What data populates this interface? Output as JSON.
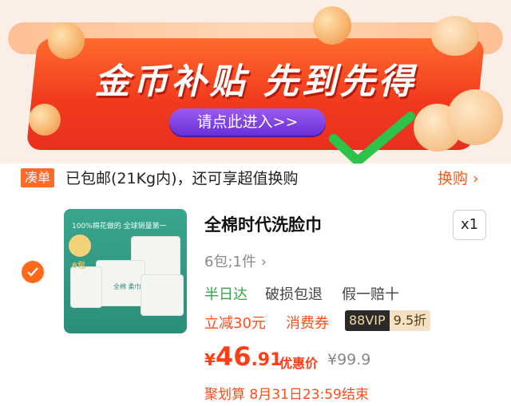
{
  "banner": {
    "title": "金币补贴 先到先得",
    "button_label": "请点此进入>>"
  },
  "shipping": {
    "tag": "凑单",
    "text": "已包邮(21Kg内)，还可享超值换购",
    "action": "换购 ›"
  },
  "product": {
    "title": "全棉时代洗脸巾",
    "quantity": "x1",
    "spec": "6包;1件 ›",
    "image_caption": "100%棉花做的 全球销量第一",
    "image_pack_label": "全棉 柔巾",
    "image_badge": "6包",
    "services": [
      {
        "label": "半日达",
        "color": "#3aa548"
      },
      {
        "label": "破损包退",
        "color": "#444444"
      },
      {
        "label": "假一赔十",
        "color": "#444444"
      }
    ],
    "promos": [
      "立减30元",
      "消费券"
    ],
    "vip_label": "88VIP",
    "vip_discount": "9.5折",
    "price_symbol": "¥",
    "price_int": "46",
    "price_dec": ".91",
    "price_label": "优惠价",
    "original_price": "¥99.9",
    "deal_text": "聚划算 8月31日23:59结束"
  },
  "colors": {
    "accent": "#ff4d1a",
    "banner_red": "#f13b1e",
    "button_purple": "#7a3ce0",
    "check_green": "#2fc24a"
  }
}
